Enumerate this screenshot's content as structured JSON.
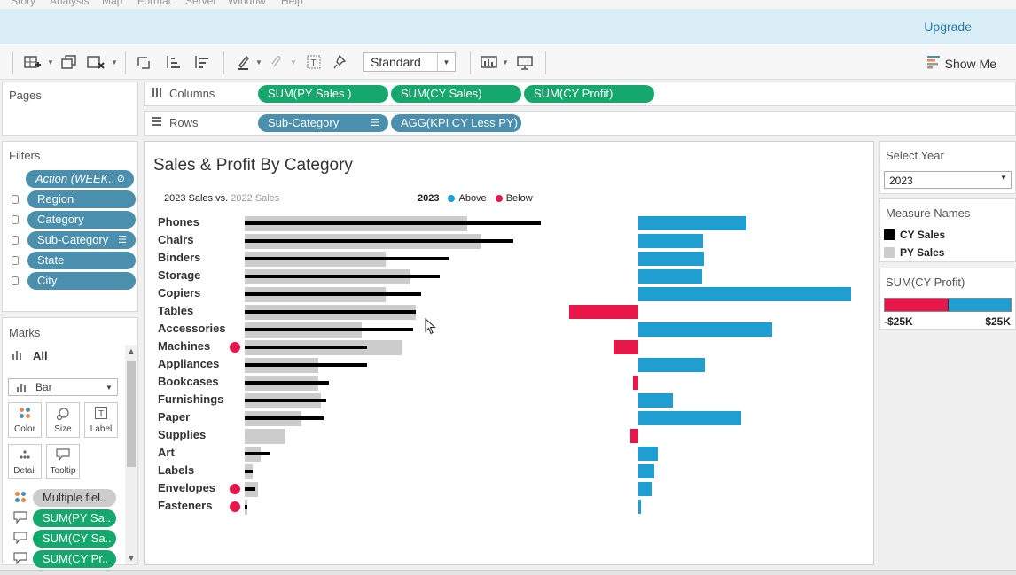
{
  "menu": [
    "Story",
    "Analysis",
    "Map",
    "Format",
    "Server",
    "Window",
    "Help"
  ],
  "upgrade_label": "Upgrade",
  "toolbar": {
    "fit_select": "Standard",
    "show_me": "Show Me"
  },
  "pages": {
    "title": "Pages"
  },
  "columns": {
    "label": "Columns",
    "pills": [
      "SUM(PY Sales )",
      "SUM(CY Sales)",
      "SUM(CY Profit)"
    ]
  },
  "rows": {
    "label": "Rows",
    "pills": [
      "Sub-Category",
      "AGG(KPI CY Less PY)"
    ]
  },
  "filters": {
    "title": "Filters",
    "items": [
      "Action (WEEK..",
      "Region",
      "Category",
      "Sub-Category",
      "State",
      "City"
    ]
  },
  "marks": {
    "title": "Marks",
    "all_label": "All",
    "mark_type": "Bar",
    "cards": [
      "Color",
      "Size",
      "Label",
      "Detail",
      "Tooltip"
    ],
    "fields": [
      "Multiple fiel..",
      "SUM(PY Sa..",
      "SUM(CY Sa..",
      "SUM(CY Pr.."
    ]
  },
  "viz": {
    "title": "Sales & Profit By Category",
    "subtitle_cy": "2023 Sales",
    "subtitle_vs": " vs. ",
    "subtitle_py": "2022 Sales",
    "legend_year": "2023",
    "legend_above": "Above",
    "legend_below": "Below"
  },
  "select_year": {
    "title": "Select Year",
    "value": "2023"
  },
  "measure_names": {
    "title": "Measure Names",
    "items": [
      "CY Sales",
      "PY Sales"
    ]
  },
  "profit_legend": {
    "title": "SUM(CY Profit)",
    "min_label": "-$25K",
    "max_label": "$25K"
  },
  "colors": {
    "cy": "#000000",
    "py": "#cccccc",
    "above": "#1f9ed1",
    "below": "#e8174a",
    "pill_green": "#15a76b",
    "pill_blue": "#4a8fad"
  },
  "chart_data": {
    "type": "bar",
    "title": "Sales & Profit By Category",
    "categories": [
      "Phones",
      "Chairs",
      "Binders",
      "Storage",
      "Copiers",
      "Tables",
      "Accessories",
      "Machines",
      "Appliances",
      "Bookcases",
      "Furnishings",
      "Paper",
      "Supplies",
      "Art",
      "Labels",
      "Envelopes",
      "Fasteners"
    ],
    "series": [
      {
        "name": "PY Sales",
        "values": [
          82000,
          87000,
          52000,
          61000,
          52000,
          63000,
          43000,
          58000,
          27000,
          27000,
          28000,
          21000,
          15000,
          6000,
          3000,
          5000,
          1000
        ]
      },
      {
        "name": "CY Sales",
        "values": [
          109000,
          99000,
          75000,
          72000,
          65000,
          63000,
          62000,
          45000,
          45000,
          31000,
          30000,
          29000,
          0,
          9000,
          3000,
          4000,
          1000
        ]
      },
      {
        "name": "CY Profit",
        "values": [
          12500,
          7500,
          7600,
          7300,
          24500,
          -8000,
          15400,
          -2900,
          7700,
          -600,
          4000,
          11800,
          -900,
          2200,
          1800,
          1500,
          300
        ]
      }
    ],
    "below_py": [
      false,
      false,
      false,
      false,
      false,
      false,
      false,
      true,
      false,
      false,
      false,
      false,
      false,
      false,
      false,
      true,
      true
    ],
    "xlabel": "",
    "ylabel": ""
  }
}
